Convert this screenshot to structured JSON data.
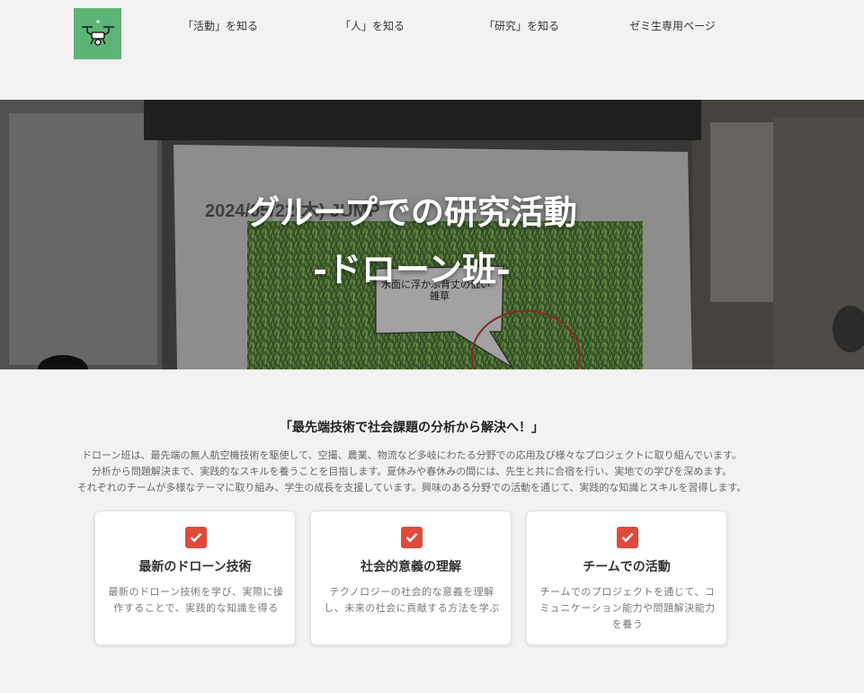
{
  "header": {
    "logo_icon": "drone-icon",
    "logo_bg": "#5cb576",
    "nav": [
      {
        "label": "「活動」を知る"
      },
      {
        "label": "「人」を知る"
      },
      {
        "label": "「研究」を知る"
      },
      {
        "label": "ゼミ生専用ページ"
      }
    ]
  },
  "hero": {
    "title_line1": "グループでの研究活動",
    "title_line2": "-ドローン班-",
    "slide_text_line1": "水面に浮かぶ背丈の低い",
    "slide_text_line2": "雑草",
    "slide_heading": "2024/05/22(木) JUMP"
  },
  "main": {
    "tagline": "「最先端技術で社会課題の分析から解決へ！」",
    "desc_lines": [
      "ドローン班は、最先端の無人航空機技術を駆使して、空撮、農業、物流など多岐にわたる分野での応用及び様々なプロジェクトに取り組んでいます。",
      "分析から問題解決まで、実践的なスキルを養うことを目指します。夏休みや春休みの間には、先生と共に合宿を行い、実地での学びを深めます。",
      "それぞれのチームが多様なテーマに取り組み、学生の成長を支援しています。興味のある分野での活動を通じて、実践的な知識とスキルを習得します。"
    ],
    "accent_color": "#e04a3b",
    "cards": [
      {
        "icon": "checkbox-icon",
        "title": "最新のドローン技術",
        "text": "最新のドローン技術を学び、実際に操作することで、実践的な知識を得る"
      },
      {
        "icon": "checkbox-icon",
        "title": "社会的意義の理解",
        "text": "テクノロジーの社会的な意義を理解し、未来の社会に貢献する方法を学ぶ"
      },
      {
        "icon": "checkbox-icon",
        "title": "チームでの活動",
        "text": "チームでのプロジェクトを通じて、コミュニケーション能力や問題解決能力を養う"
      }
    ]
  }
}
